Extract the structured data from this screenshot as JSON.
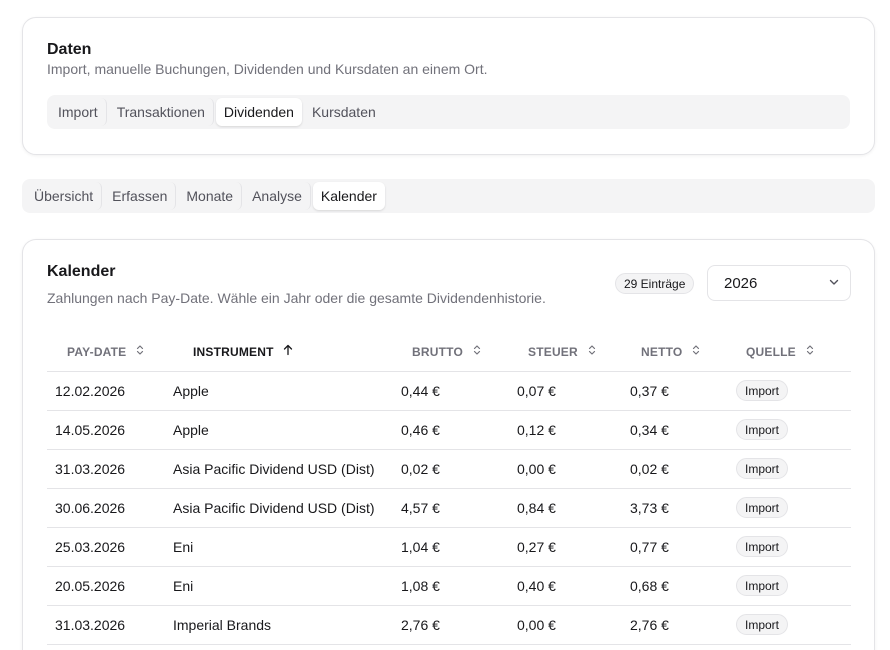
{
  "daten": {
    "title": "Daten",
    "description": "Import, manuelle Buchungen, Dividenden und Kursdaten an einem Ort.",
    "tabs": [
      "Import",
      "Transaktionen",
      "Dividenden",
      "Kursdaten"
    ],
    "active_tab": "Dividenden"
  },
  "subtabs": {
    "items": [
      "Übersicht",
      "Erfassen",
      "Monate",
      "Analyse",
      "Kalender"
    ],
    "active": "Kalender"
  },
  "kalender": {
    "title": "Kalender",
    "description": "Zahlungen nach Pay-Date. Wähle ein Jahr oder die gesamte Dividendenhistorie.",
    "count_badge": "29 Einträge",
    "year_select": "2026",
    "columns": [
      "PAY-DATE",
      "INSTRUMENT",
      "BRUTTO",
      "STEUER",
      "NETTO",
      "QUELLE"
    ],
    "sorted_column": "INSTRUMENT",
    "rows": [
      {
        "date": "12.02.2026",
        "instrument": "Apple",
        "brutto": "0,44 €",
        "steuer": "0,07 €",
        "netto": "0,37 €",
        "quelle": "Import"
      },
      {
        "date": "14.05.2026",
        "instrument": "Apple",
        "brutto": "0,46 €",
        "steuer": "0,12 €",
        "netto": "0,34 €",
        "quelle": "Import"
      },
      {
        "date": "31.03.2026",
        "instrument": "Asia Pacific Dividend USD (Dist)",
        "brutto": "0,02 €",
        "steuer": "0,00 €",
        "netto": "0,02 €",
        "quelle": "Import"
      },
      {
        "date": "30.06.2026",
        "instrument": "Asia Pacific Dividend USD (Dist)",
        "brutto": "4,57 €",
        "steuer": "0,84 €",
        "netto": "3,73 €",
        "quelle": "Import"
      },
      {
        "date": "25.03.2026",
        "instrument": "Eni",
        "brutto": "1,04 €",
        "steuer": "0,27 €",
        "netto": "0,77 €",
        "quelle": "Import"
      },
      {
        "date": "20.05.2026",
        "instrument": "Eni",
        "brutto": "1,08 €",
        "steuer": "0,40 €",
        "netto": "0,68 €",
        "quelle": "Import"
      },
      {
        "date": "31.03.2026",
        "instrument": "Imperial Brands",
        "brutto": "2,76 €",
        "steuer": "0,00 €",
        "netto": "2,76 €",
        "quelle": "Import"
      }
    ]
  }
}
